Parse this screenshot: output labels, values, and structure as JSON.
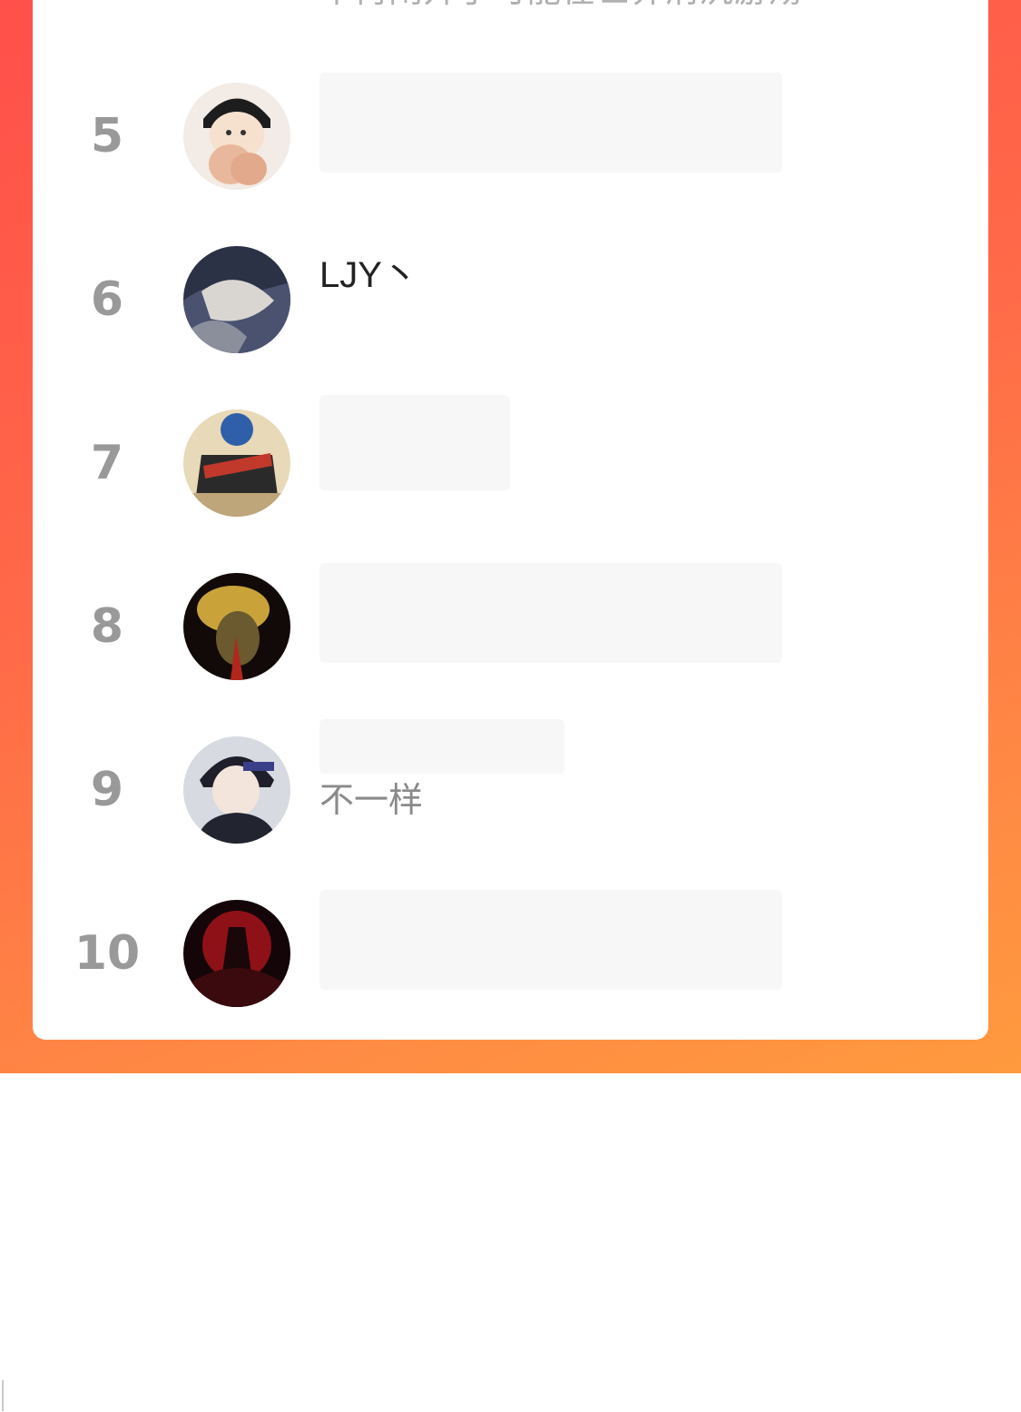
{
  "leaderboard": {
    "partial_row": {
      "subtitle": "不再闹开了可能在世界消沉游荡"
    },
    "rows": [
      {
        "rank": "5",
        "name": "",
        "subtitle": ""
      },
      {
        "rank": "6",
        "name": "LJY丶",
        "subtitle": ""
      },
      {
        "rank": "7",
        "name": "",
        "subtitle": ""
      },
      {
        "rank": "8",
        "name": "",
        "subtitle": ""
      },
      {
        "rank": "9",
        "name": "",
        "subtitle": "不一样"
      },
      {
        "rank": "10",
        "name": "",
        "subtitle": ""
      }
    ]
  },
  "colors": {
    "background_gradient_start": "#ff4f4a",
    "background_gradient_end": "#ff9a3e",
    "card": "#ffffff",
    "rank_text": "#999999"
  }
}
